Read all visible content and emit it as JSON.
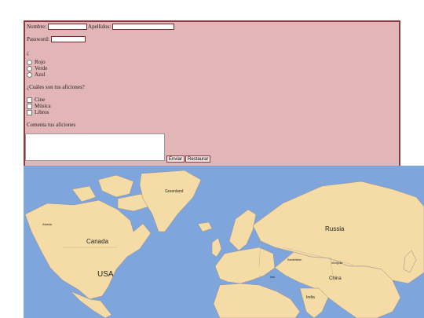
{
  "form": {
    "nombre_label": "Nombre:",
    "nombre_value": "",
    "apellidos_label": "Apellidos:",
    "apellidos_value": "",
    "password_label": "Password:",
    "password_value": "",
    "color_question": "¿",
    "colors": [
      "Rojo",
      "Verde",
      "Azul"
    ],
    "hobbies_question": "¿Cuáles son tus aficiones?",
    "hobbies": [
      "Cine",
      "Música",
      "Libros"
    ],
    "comment_label": "Comenta tus aficiones",
    "comment_value": "",
    "submit_label": "Enviar",
    "reset_label": "Restaurar"
  },
  "map": {
    "labels": {
      "greenland": "Greenland",
      "alaska": "Alaska",
      "canada": "Canada",
      "usa": "USA",
      "russia": "Russia",
      "china": "China",
      "india": "India",
      "mongolia": "Mongolia",
      "kazakhstan": "Kazakhstan",
      "iran": "Iran"
    },
    "colors": {
      "water": "#7fa6dc",
      "land": "#f5dca6",
      "border": "#9a8a8a"
    }
  }
}
